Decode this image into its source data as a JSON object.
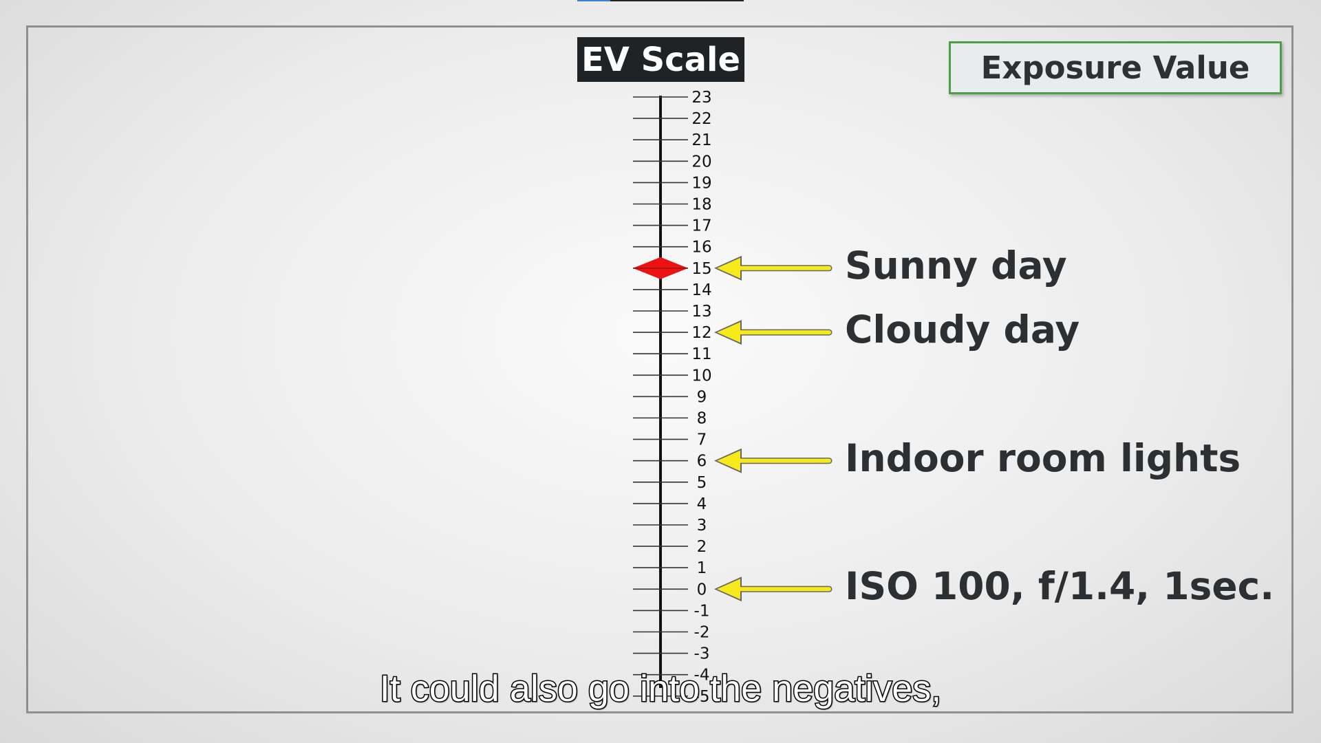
{
  "title": "EV Scale",
  "label_box": "Exposure Value",
  "subtitle": "It could also go into the negatives,",
  "scale": {
    "ticks": [
      23,
      22,
      21,
      20,
      19,
      18,
      17,
      16,
      15,
      14,
      13,
      12,
      11,
      10,
      9,
      8,
      7,
      6,
      5,
      4,
      3,
      2,
      1,
      0,
      -1,
      -2,
      -3,
      -4,
      -5
    ],
    "marker_value": 15,
    "marker_color": "#ee1111",
    "arrow_color": "#f7ea1a"
  },
  "annotations": [
    {
      "text": "Sunny day",
      "value": 15
    },
    {
      "text": "Cloudy day",
      "value": 12
    },
    {
      "text": "Indoor room lights",
      "value": 6
    },
    {
      "text": "ISO 100, f/1.4, 1sec.",
      "value": 0
    }
  ]
}
